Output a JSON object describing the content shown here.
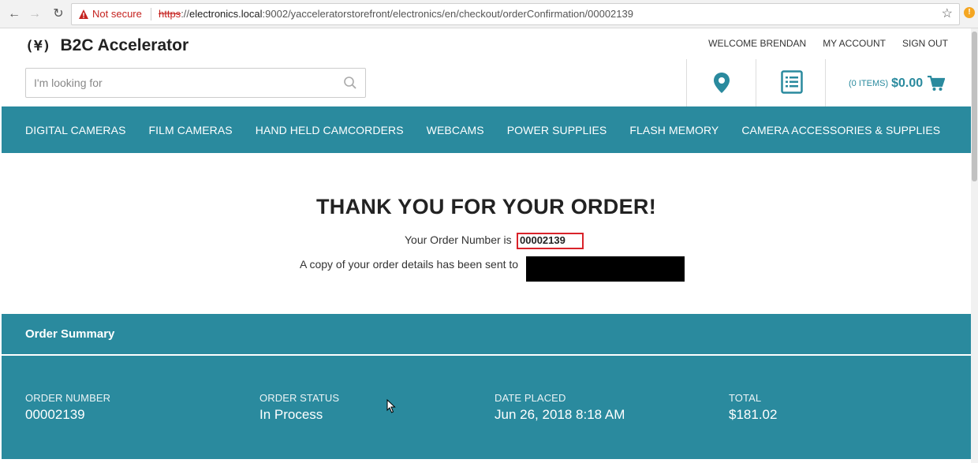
{
  "browser": {
    "not_secure": "Not secure",
    "url_scheme": "https",
    "url_sep": "://",
    "url_host": "electronics.local",
    "url_rest": ":9002/yacceleratorstorefront/electronics/en/checkout/orderConfirmation/00002139"
  },
  "header": {
    "logo_mark": "(¥)",
    "logo_text": "B2C Accelerator",
    "links": [
      "WELCOME BRENDAN",
      "MY ACCOUNT",
      "SIGN OUT"
    ],
    "search_placeholder": "I'm looking for",
    "cart_items": "(0 ITEMS)",
    "cart_total": "$0.00"
  },
  "categories": [
    "DIGITAL CAMERAS",
    "FILM CAMERAS",
    "HAND HELD CAMCORDERS",
    "WEBCAMS",
    "POWER SUPPLIES",
    "FLASH MEMORY",
    "CAMERA ACCESSORIES & SUPPLIES"
  ],
  "confirmation": {
    "title": "THANK YOU FOR YOUR ORDER!",
    "order_line": "Your Order Number is",
    "order_number": "00002139",
    "copy_line": "A copy of your order details has been sent to"
  },
  "summary": {
    "title": "Order Summary",
    "fields": [
      {
        "label": "ORDER NUMBER",
        "value": "00002139"
      },
      {
        "label": "ORDER STATUS",
        "value": "In Process"
      },
      {
        "label": "DATE PLACED",
        "value": "Jun 26, 2018 8:18 AM"
      },
      {
        "label": "TOTAL",
        "value": "$181.02"
      }
    ]
  },
  "colors": {
    "accent": "#2a8a9e",
    "highlight_box": "#d9232a"
  },
  "icons": [
    "back-arrow-icon",
    "forward-arrow-icon",
    "reload-icon",
    "warning-icon",
    "star-icon",
    "extension-icon",
    "search-icon",
    "map-marker-icon",
    "list-icon",
    "cart-icon",
    "mouse-cursor-icon"
  ]
}
